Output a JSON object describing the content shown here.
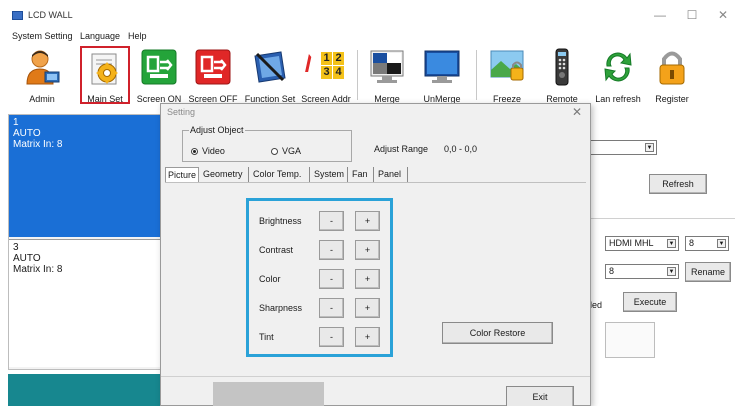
{
  "window": {
    "title": "LCD WALL",
    "controls": {
      "minimize": "—",
      "maximize": "☐",
      "close": "✕"
    }
  },
  "menu": [
    "System Setting",
    "Language",
    "Help"
  ],
  "toolbar": {
    "items": [
      {
        "label": "Admin",
        "icon": "admin-user-icon"
      },
      {
        "label": "Main Set",
        "icon": "main-set-gear-icon",
        "selected": true
      },
      {
        "label": "Screen ON",
        "icon": "screen-on-icon"
      },
      {
        "label": "Screen OFF",
        "icon": "screen-off-icon"
      },
      {
        "label": "Function Set",
        "icon": "function-set-icon"
      },
      {
        "label": "Screen Addr",
        "icon": "screen-addr-icon"
      },
      {
        "label": "Merge",
        "icon": "merge-icon"
      },
      {
        "label": "UnMerge",
        "icon": "unmerge-icon"
      },
      {
        "label": "Freeze",
        "icon": "freeze-icon"
      },
      {
        "label": "Remote",
        "icon": "remote-icon"
      },
      {
        "label": "Lan refresh",
        "icon": "lan-refresh-icon"
      },
      {
        "label": "Register",
        "icon": "register-lock-icon"
      }
    ],
    "addr_digits": [
      "1",
      "2",
      "3",
      "4"
    ]
  },
  "screens": [
    {
      "number": "1",
      "mode": "AUTO",
      "matrix": "Matrix In: 8"
    },
    {
      "number": "3",
      "mode": "AUTO",
      "matrix": "Matrix In: 8"
    }
  ],
  "right_panel": {
    "refresh_label": "Refresh",
    "source_value": "HDMI MHL",
    "channel_value": "8",
    "name_value": "8",
    "rename_label": "Rename",
    "enabled_fragment": "bled",
    "execute_label": "Execute"
  },
  "dialog": {
    "title": "Setting",
    "adjust_object": {
      "title": "Adjust Object",
      "options": [
        "Video",
        "VGA"
      ],
      "selected": "Video"
    },
    "adjust_range_label": "Adjust Range",
    "adjust_range_value": "0,0 - 0,0",
    "tabs": [
      "Picture",
      "Geometry",
      "Color Temp.",
      "System",
      "Fan",
      "Panel"
    ],
    "active_tab": "Picture",
    "picture_rows": [
      {
        "label": "Brightness",
        "minus": "-",
        "plus": "+"
      },
      {
        "label": "Contrast",
        "minus": "-",
        "plus": "+"
      },
      {
        "label": "Color",
        "minus": "-",
        "plus": "+"
      },
      {
        "label": "Sharpness",
        "minus": "-",
        "plus": "+"
      },
      {
        "label": "Tint",
        "minus": "-",
        "plus": "+"
      }
    ],
    "color_restore_label": "Color Restore",
    "exit_label": "Exit"
  },
  "colors": {
    "selected_screen": "#1a6fd6",
    "highlight_border": "#2aa2d8",
    "toolbar_selection": "#d0212b",
    "teal_bar": "#17878f"
  }
}
